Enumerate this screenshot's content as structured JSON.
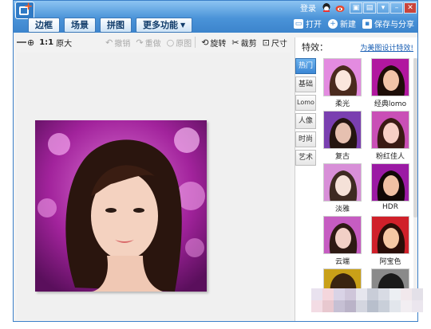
{
  "titlebar": {
    "tabs": [
      {
        "label": "边框"
      },
      {
        "label": "场景"
      },
      {
        "label": "拼图"
      },
      {
        "label": "更多功能"
      }
    ],
    "login_label": "登录",
    "actions": [
      {
        "label": "打开",
        "icon": "folder-open-icon"
      },
      {
        "label": "新建",
        "icon": "plus-circle-icon"
      },
      {
        "label": "保存与分享",
        "icon": "save-icon"
      }
    ]
  },
  "toolbar": {
    "zoom_ratio": "1:1",
    "original_label": "原大",
    "undo_label": "撤销",
    "redo_label": "重做",
    "reset_label": "原图",
    "rotate_label": "旋转",
    "crop_label": "裁剪",
    "size_label": "尺寸"
  },
  "panel": {
    "title": "特效：",
    "link": "为美图设计特效!",
    "categories": [
      {
        "label": "热门"
      },
      {
        "label": "基础"
      },
      {
        "label": "Lomo"
      },
      {
        "label": "人像"
      },
      {
        "label": "时尚"
      },
      {
        "label": "艺术"
      }
    ],
    "effects": [
      {
        "label": "柔光"
      },
      {
        "label": "经典lomo"
      },
      {
        "label": "复古"
      },
      {
        "label": "粉红佳人"
      },
      {
        "label": "淡雅"
      },
      {
        "label": "HDR"
      },
      {
        "label": "云端"
      },
      {
        "label": "阿宝色"
      }
    ]
  },
  "colors": {
    "accent": "#3c84cc",
    "active_tab": "#3b86d4",
    "link": "#1a5fb4"
  }
}
